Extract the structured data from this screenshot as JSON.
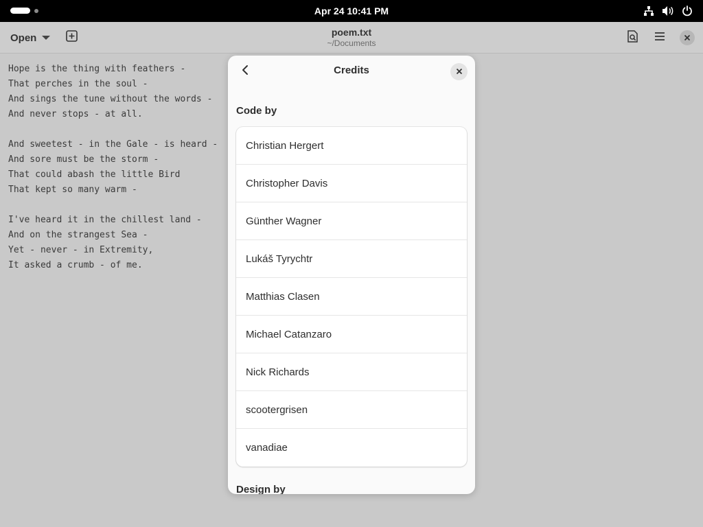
{
  "system": {
    "clock": "Apr 24  10:41 PM",
    "icons": [
      "network-icon",
      "volume-icon",
      "power-icon"
    ]
  },
  "header": {
    "open_label": "Open",
    "doc_title": "poem.txt",
    "doc_path": "~/Documents"
  },
  "poem": {
    "lines": [
      "Hope is the thing with feathers -",
      "That perches in the soul -",
      "And sings the tune without the words -",
      "And never stops - at all.",
      "",
      "And sweetest - in the Gale - is heard -",
      "And sore must be the storm -",
      "That could abash the little Bird",
      "That kept so many warm -",
      "",
      "I've heard it in the chillest land -",
      "And on the strangest Sea -",
      "Yet - never - in Extremity,",
      "It asked a crumb - of me."
    ]
  },
  "dialog": {
    "title": "Credits",
    "code_section_title": "Code by",
    "code_authors": [
      "Christian Hergert",
      "Christopher Davis",
      "Günther Wagner",
      "Lukáš Tyrychtr",
      "Matthias Clasen",
      "Michael Catanzaro",
      "Nick Richards",
      "scootergrisen",
      "vanadiae"
    ],
    "design_section_title": "Design by"
  },
  "colors": {
    "background": "#c9c9c9",
    "dialog_bg": "#fafafa",
    "topbar": "#000000"
  }
}
